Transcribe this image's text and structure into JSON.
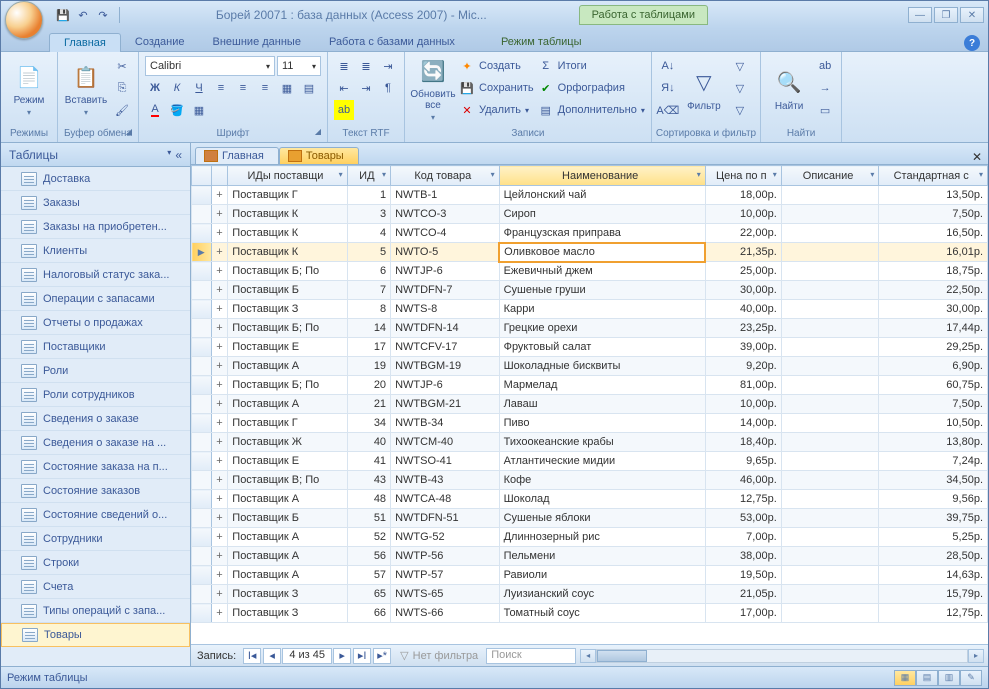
{
  "titlebar": {
    "title": "Борей 20071 : база данных (Access 2007) - Mic...",
    "contextTab": "Работа с таблицами"
  },
  "ribbonTabs": [
    "Главная",
    "Создание",
    "Внешние данные",
    "Работа с базами данных",
    "Режим таблицы"
  ],
  "ribbon": {
    "mode": "Режим",
    "modeGroup": "Режимы",
    "paste": "Вставить",
    "clipboard": "Буфер обмена",
    "fontName": "Calibri",
    "fontSize": "11",
    "fontGroup": "Шрифт",
    "rtfGroup": "Текст RTF",
    "refresh": "Обновить все",
    "create": "Создать",
    "save": "Сохранить",
    "delete": "Удалить",
    "totals": "Итоги",
    "spelling": "Орфография",
    "more": "Дополнительно",
    "recordsGroup": "Записи",
    "filter": "Фильтр",
    "sortGroup": "Сортировка и фильтр",
    "find": "Найти",
    "findGroup": "Найти"
  },
  "nav": {
    "header": "Таблицы",
    "items": [
      "Доставка",
      "Заказы",
      "Заказы на приобретен...",
      "Клиенты",
      "Налоговый статус зака...",
      "Операции с запасами",
      "Отчеты о продажах",
      "Поставщики",
      "Роли",
      "Роли сотрудников",
      "Сведения о заказе",
      "Сведения о заказе на ...",
      "Состояние заказа на п...",
      "Состояние заказов",
      "Состояние сведений о...",
      "Сотрудники",
      "Строки",
      "Счета",
      "Типы операций с запа...",
      "Товары"
    ]
  },
  "docTabs": {
    "t1": "Главная",
    "t2": "Товары"
  },
  "columns": [
    "",
    "",
    "ИДы поставщи",
    "ИД",
    "Код товара",
    "Наименование",
    "Цена по п",
    "Описание",
    "Стандартная с"
  ],
  "rows": [
    {
      "sup": "Поставщик Г",
      "id": "1",
      "code": "NWTB-1",
      "name": "Цейлонский чай",
      "price": "18,00р.",
      "desc": "",
      "std": "13,50р."
    },
    {
      "sup": "Поставщик К",
      "id": "3",
      "code": "NWTCO-3",
      "name": "Сироп",
      "price": "10,00р.",
      "desc": "",
      "std": "7,50р."
    },
    {
      "sup": "Поставщик К",
      "id": "4",
      "code": "NWTCO-4",
      "name": "Французская приправа",
      "price": "22,00р.",
      "desc": "",
      "std": "16,50р."
    },
    {
      "sup": "Поставщик К",
      "id": "5",
      "code": "NWTO-5",
      "name": "Оливковое масло",
      "price": "21,35р.",
      "desc": "",
      "std": "16,01р."
    },
    {
      "sup": "Поставщик Б; По",
      "id": "6",
      "code": "NWTJP-6",
      "name": "Ежевичный джем",
      "price": "25,00р.",
      "desc": "",
      "std": "18,75р."
    },
    {
      "sup": "Поставщик Б",
      "id": "7",
      "code": "NWTDFN-7",
      "name": "Сушеные груши",
      "price": "30,00р.",
      "desc": "",
      "std": "22,50р."
    },
    {
      "sup": "Поставщик З",
      "id": "8",
      "code": "NWTS-8",
      "name": "Карри",
      "price": "40,00р.",
      "desc": "",
      "std": "30,00р."
    },
    {
      "sup": "Поставщик Б; По",
      "id": "14",
      "code": "NWTDFN-14",
      "name": "Грецкие орехи",
      "price": "23,25р.",
      "desc": "",
      "std": "17,44р."
    },
    {
      "sup": "Поставщик Е",
      "id": "17",
      "code": "NWTCFV-17",
      "name": "Фруктовый салат",
      "price": "39,00р.",
      "desc": "",
      "std": "29,25р."
    },
    {
      "sup": "Поставщик А",
      "id": "19",
      "code": "NWTBGM-19",
      "name": "Шоколадные бисквиты",
      "price": "9,20р.",
      "desc": "",
      "std": "6,90р."
    },
    {
      "sup": "Поставщик Б; По",
      "id": "20",
      "code": "NWTJP-6",
      "name": "Мармелад",
      "price": "81,00р.",
      "desc": "",
      "std": "60,75р."
    },
    {
      "sup": "Поставщик А",
      "id": "21",
      "code": "NWTBGM-21",
      "name": "Лаваш",
      "price": "10,00р.",
      "desc": "",
      "std": "7,50р."
    },
    {
      "sup": "Поставщик Г",
      "id": "34",
      "code": "NWTB-34",
      "name": "Пиво",
      "price": "14,00р.",
      "desc": "",
      "std": "10,50р."
    },
    {
      "sup": "Поставщик Ж",
      "id": "40",
      "code": "NWTCM-40",
      "name": "Тихоокеанские крабы",
      "price": "18,40р.",
      "desc": "",
      "std": "13,80р."
    },
    {
      "sup": "Поставщик Е",
      "id": "41",
      "code": "NWTSO-41",
      "name": "Атлантические мидии",
      "price": "9,65р.",
      "desc": "",
      "std": "7,24р."
    },
    {
      "sup": "Поставщик В; По",
      "id": "43",
      "code": "NWTB-43",
      "name": "Кофе",
      "price": "46,00р.",
      "desc": "",
      "std": "34,50р."
    },
    {
      "sup": "Поставщик А",
      "id": "48",
      "code": "NWTCA-48",
      "name": "Шоколад",
      "price": "12,75р.",
      "desc": "",
      "std": "9,56р."
    },
    {
      "sup": "Поставщик Б",
      "id": "51",
      "code": "NWTDFN-51",
      "name": "Сушеные яблоки",
      "price": "53,00р.",
      "desc": "",
      "std": "39,75р."
    },
    {
      "sup": "Поставщик А",
      "id": "52",
      "code": "NWTG-52",
      "name": "Длиннозерный рис",
      "price": "7,00р.",
      "desc": "",
      "std": "5,25р."
    },
    {
      "sup": "Поставщик А",
      "id": "56",
      "code": "NWTP-56",
      "name": "Пельмени",
      "price": "38,00р.",
      "desc": "",
      "std": "28,50р."
    },
    {
      "sup": "Поставщик А",
      "id": "57",
      "code": "NWTP-57",
      "name": "Равиоли",
      "price": "19,50р.",
      "desc": "",
      "std": "14,63р."
    },
    {
      "sup": "Поставщик З",
      "id": "65",
      "code": "NWTS-65",
      "name": "Луизианский соус",
      "price": "21,05р.",
      "desc": "",
      "std": "15,79р."
    },
    {
      "sup": "Поставщик З",
      "id": "66",
      "code": "NWTS-66",
      "name": "Томатный соус",
      "price": "17,00р.",
      "desc": "",
      "std": "12,75р."
    }
  ],
  "selectedRow": 3,
  "recnav": {
    "label": "Запись:",
    "pos": "4 из 45",
    "filter": "Нет фильтра",
    "search": "Поиск"
  },
  "status": "Режим таблицы"
}
